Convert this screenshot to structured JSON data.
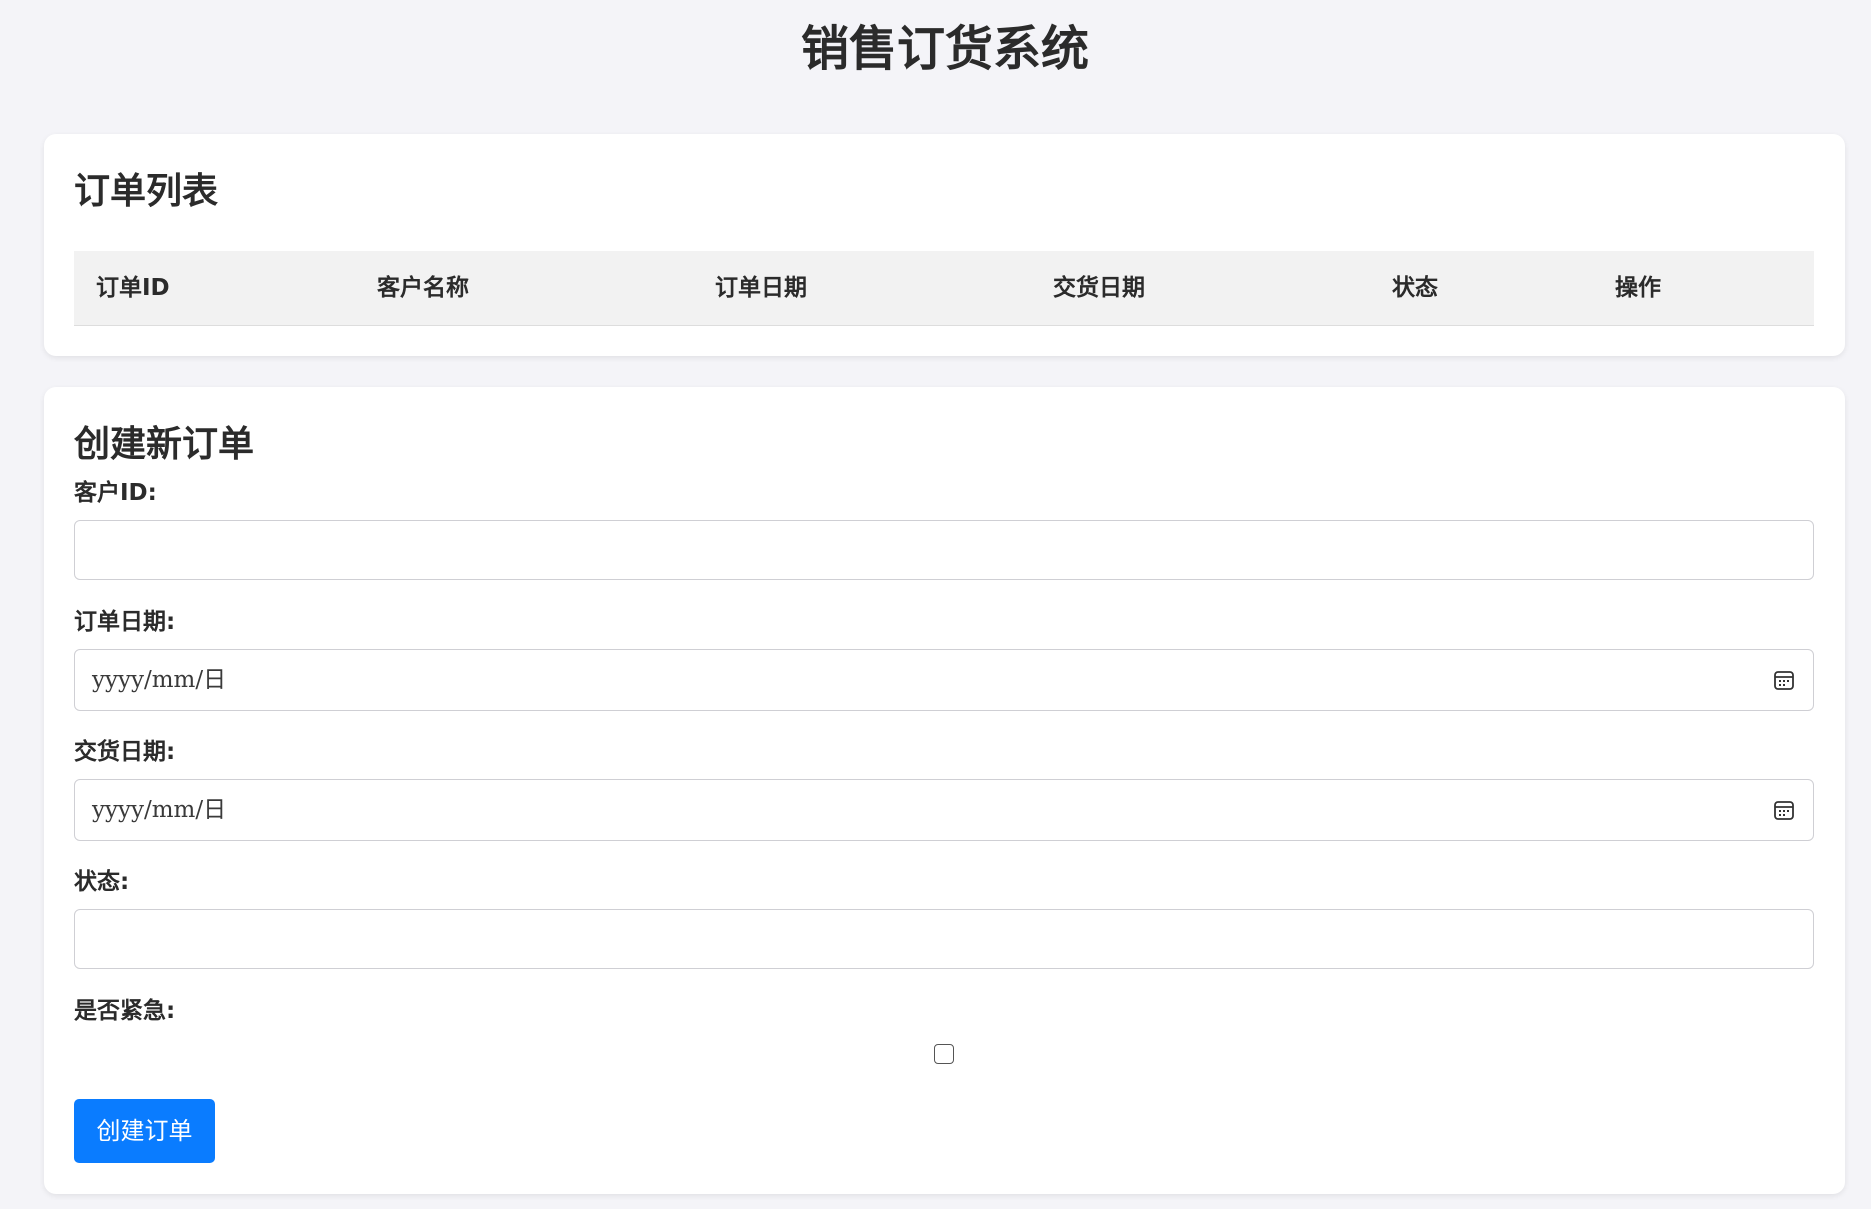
{
  "page": {
    "title": "销售订货系统"
  },
  "order_list": {
    "title": "订单列表",
    "columns": [
      "订单ID",
      "客户名称",
      "订单日期",
      "交货日期",
      "状态",
      "操作"
    ],
    "rows": []
  },
  "create_order": {
    "title": "创建新订单",
    "customer_id": {
      "label": "客户ID:",
      "value": ""
    },
    "order_date": {
      "label": "订单日期:",
      "placeholder": "yyyy/mm/日"
    },
    "delivery_date": {
      "label": "交货日期:",
      "placeholder": "yyyy/mm/日"
    },
    "status": {
      "label": "状态:",
      "value": ""
    },
    "urgent": {
      "label": "是否紧急:",
      "checked": false
    },
    "submit_label": "创建订单"
  },
  "colors": {
    "background": "#f4f4f8",
    "card": "#ffffff",
    "table_header": "#f2f2f2",
    "primary_button": "#0a7cff"
  },
  "icons": {
    "date_picker": "calendar-icon"
  }
}
